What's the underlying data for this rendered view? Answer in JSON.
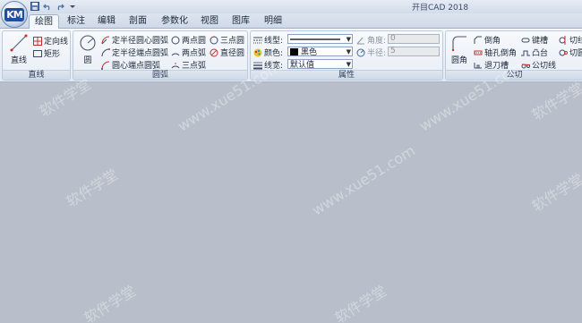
{
  "app": {
    "title": "开目CAD 2018",
    "logo_text": "KM"
  },
  "quick_access": [
    {
      "name": "save-icon",
      "glyph": "■"
    },
    {
      "name": "undo-icon",
      "glyph": "↶"
    },
    {
      "name": "redo-icon",
      "glyph": "↷"
    },
    {
      "name": "customize-icon",
      "glyph": "▾"
    }
  ],
  "tabs": [
    {
      "label": "绘图",
      "active": true
    },
    {
      "label": "标注"
    },
    {
      "label": "编辑"
    },
    {
      "label": "剖面"
    },
    {
      "label": "参数化"
    },
    {
      "label": "视图"
    },
    {
      "label": "图库"
    },
    {
      "label": "明细"
    }
  ],
  "ribbon": {
    "line_group": {
      "label": "直线",
      "line": "直线",
      "fixed_line": "定向线",
      "rectangle": "矩形"
    },
    "arc_group": {
      "label": "圆弧",
      "circle": "圆",
      "arc_r_center": "定半径圆心圆弧",
      "arc_r_end": "定半径端点圆弧",
      "arc_center_end": "圆心端点圆弧",
      "two_point_circle": "两点圆",
      "two_point_arc": "两点弧",
      "three_point_arc": "三点弧",
      "three_point_circle": "三点圆",
      "diameter_circle": "直径圆"
    },
    "attr_group": {
      "label": "属性",
      "linetype_label": "线型:",
      "color_label": "颜色:",
      "color_value": "黑色",
      "color_swatch": "#000000",
      "linewidth_label": "线宽:",
      "linewidth_value": "默认值",
      "angle_label": "角度:",
      "angle_value": "0",
      "radius_label": "半径:",
      "radius_value": "5"
    },
    "tangent_group": {
      "label": "公切",
      "fillet": "圆角",
      "chamfer": "倒角",
      "shaft_hole_chamfer": "轴孔倒角",
      "undercut": "砂轮越程槽",
      "keyway": "键槽",
      "boss": "凸台",
      "tangent_line": "公切线",
      "cut1": "切线",
      "cut2": "切圆",
      "relief_groove": "退刀槽"
    }
  },
  "watermarks": [
    "软件学堂",
    "www.xue51.com"
  ],
  "colors": {
    "canvas": "#b9bfca",
    "accent": "#1f4fa0"
  }
}
